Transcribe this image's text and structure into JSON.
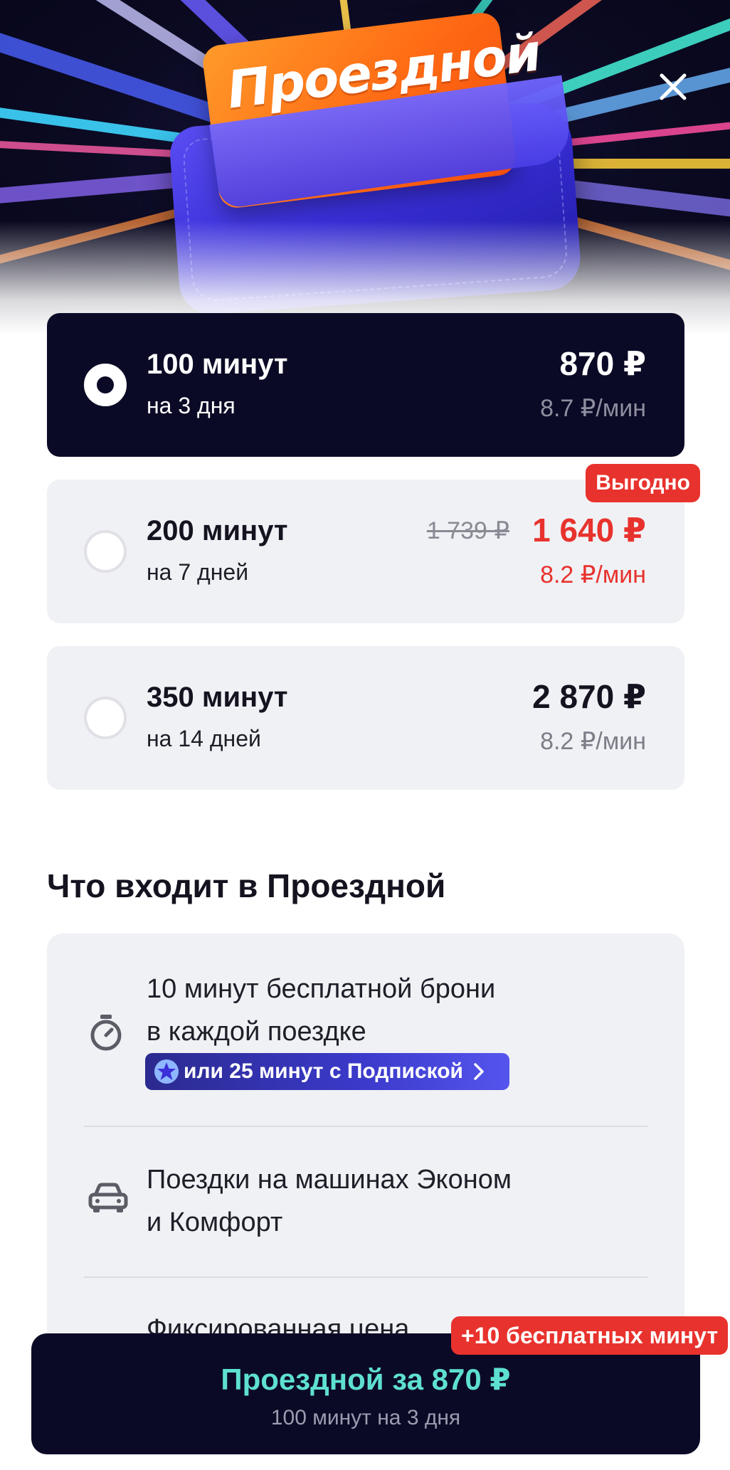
{
  "hero": {
    "card_title": "Проездной",
    "close_icon": "close-icon"
  },
  "tariffs": [
    {
      "minutes": "100 минут",
      "period": "на 3 дня",
      "price": "870 ₽",
      "rate": "8.7 ₽/мин",
      "selected": true
    },
    {
      "minutes": "200 минут",
      "period": "на 7 дней",
      "old_price": "1 739 ₽",
      "price": "1 640 ₽",
      "rate": "8.2 ₽/мин",
      "badge": "Выгодно",
      "selected": false
    },
    {
      "minutes": "350 минут",
      "period": "на 14 дней",
      "price": "2 870 ₽",
      "rate": "8.2 ₽/мин",
      "selected": false
    }
  ],
  "includes": {
    "title": "Что входит в Проездной",
    "items": [
      {
        "icon": "stopwatch-icon",
        "line1": "10 минут бесплатной брони",
        "line2": "в каждой поездке",
        "chip": "или 25 минут с Подпиской"
      },
      {
        "icon": "car-icon",
        "line1": "Поездки на машинах Эконом",
        "line2": "и Комфорт"
      },
      {
        "line1": "Фиксированная цена"
      }
    ]
  },
  "cta": {
    "title": "Проездной за 870 ₽",
    "subtitle": "100 минут на 3 дня",
    "bonus": "+10 бесплатных минут"
  },
  "colors": {
    "dark": "#0b0a26",
    "accent_red": "#e8322d",
    "accent_teal": "#5ee0cf",
    "card_bg": "#f0f1f5"
  }
}
